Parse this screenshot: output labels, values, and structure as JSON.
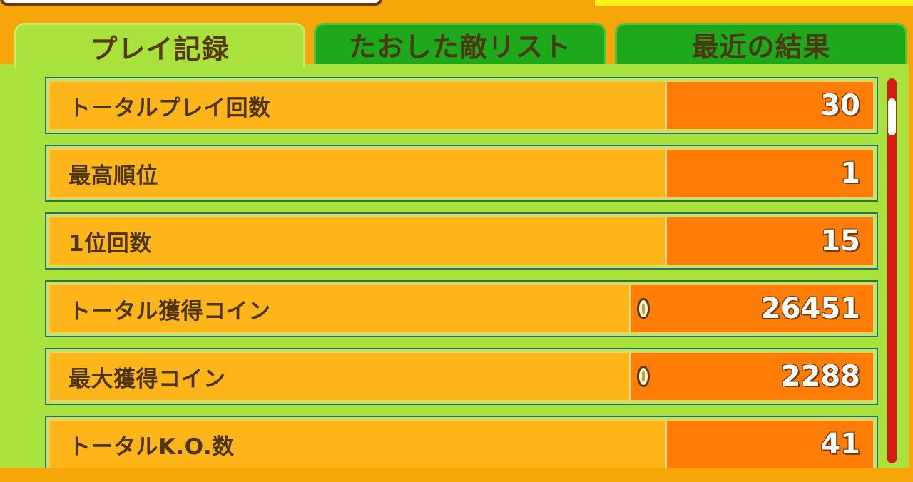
{
  "tabs": [
    {
      "label": "プレイ記録",
      "active": true
    },
    {
      "label": "たおした敵リスト",
      "active": false
    },
    {
      "label": "最近の結果",
      "active": false
    }
  ],
  "records": [
    {
      "label": "トータルプレイ回数",
      "value": "30",
      "coin_icon": false
    },
    {
      "label": "最高順位",
      "value": "1",
      "coin_icon": false
    },
    {
      "label": "1位回数",
      "value": "15",
      "coin_icon": false
    },
    {
      "label": "トータル獲得コイン",
      "value": "26451",
      "coin_icon": true
    },
    {
      "label": "最大獲得コイン",
      "value": "2288",
      "coin_icon": true
    },
    {
      "label": "トータルK.O.数",
      "value": "41",
      "coin_icon": false
    }
  ],
  "colors": {
    "background": "#f6a609",
    "panel": "#a9e23c",
    "tab_inactive": "#1ea81c",
    "row_label_bg": "#fdb51a",
    "row_value_bg": "#ff7d07",
    "scrollbar": "#d81a12",
    "text_brown": "#4f3510"
  }
}
